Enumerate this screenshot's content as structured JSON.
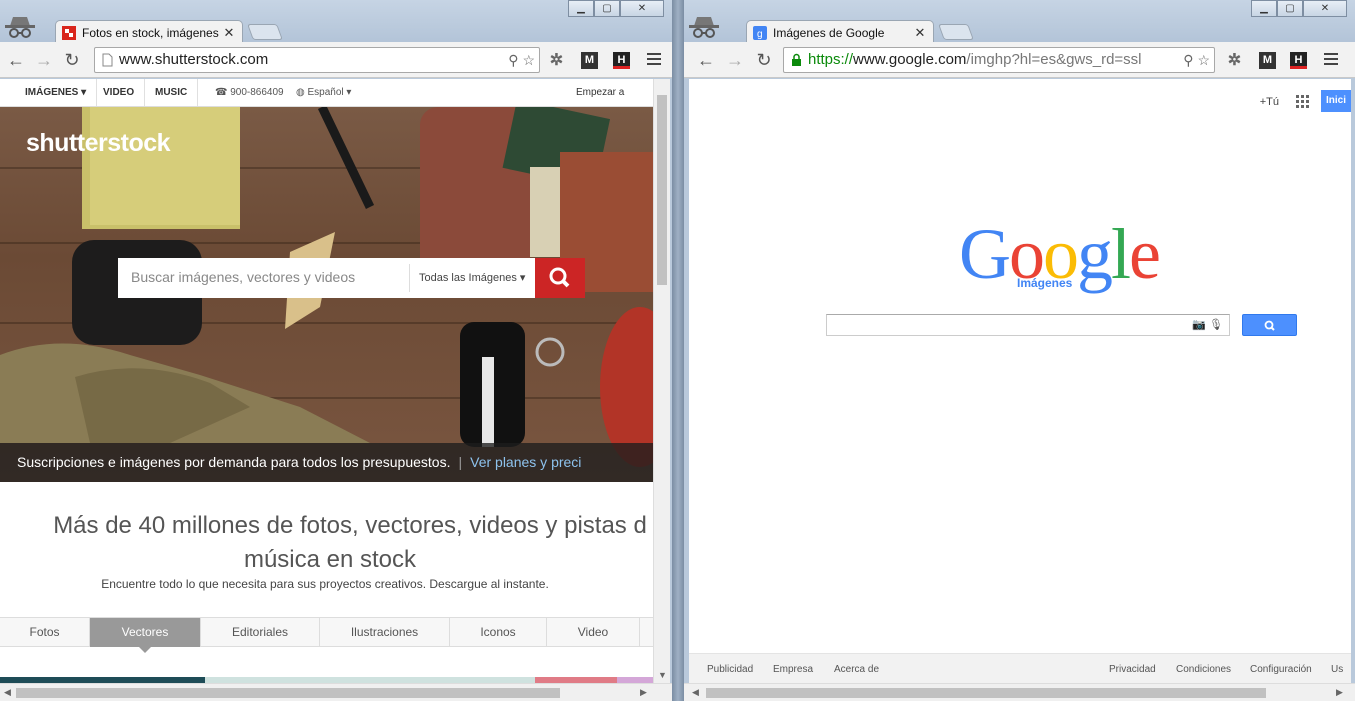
{
  "left_window": {
    "tab": {
      "title": "Fotos en stock, imágenes",
      "close": "✕"
    },
    "url": "www.shutterstock.com",
    "page": {
      "topnav": [
        "IMÁGENES ▾",
        "VIDEO",
        "MUSIC",
        "900-866409",
        "Español ▾",
        "Empezar a descar"
      ],
      "logo": "shutterstock",
      "search_placeholder": "Buscar imágenes, vectores y videos",
      "search_category": "Todas las Imágenes ▾",
      "banner_text": "Suscripciones e imágenes por demanda para todos los presupuestos.",
      "banner_sep": "|",
      "banner_cta": "Ver planes y preci",
      "headline_1": "Más de 40 millones de fotos, vectores, videos y pistas d",
      "headline_2": "música en stock",
      "subline": "Encuentre todo lo que necesita para sus proyectos creativos. Descargue al instante.",
      "tabs": [
        "Fotos",
        "Vectores",
        "Editoriales",
        "Ilustraciones",
        "Iconos",
        "Video"
      ],
      "active_tab": "Vectores"
    }
  },
  "right_window": {
    "tab": {
      "title": "Imágenes de Google",
      "close": "✕"
    },
    "url_scheme": "https://",
    "url_host": "www.google.com",
    "url_rest": "/imghp?hl=es&gws_rd=ssl",
    "page": {
      "top_links": {
        "plus": "+Tú",
        "signin": "Inici"
      },
      "logo_letters": [
        {
          "ch": "G",
          "color": "#4285f4"
        },
        {
          "ch": "o",
          "color": "#ea4335"
        },
        {
          "ch": "o",
          "color": "#fbbc05"
        },
        {
          "ch": "g",
          "color": "#4285f4"
        },
        {
          "ch": "l",
          "color": "#34a853"
        },
        {
          "ch": "e",
          "color": "#ea4335"
        }
      ],
      "logo_sub": "Imágenes",
      "footer_left": [
        "Publicidad",
        "Empresa",
        "Acerca de"
      ],
      "footer_right": [
        "Privacidad",
        "Condiciones",
        "Configuración",
        "Us"
      ]
    }
  },
  "colors": {
    "accent_red": "#cc2525",
    "google_blue": "#4d90fe",
    "https_green": "#0b8a0b"
  }
}
